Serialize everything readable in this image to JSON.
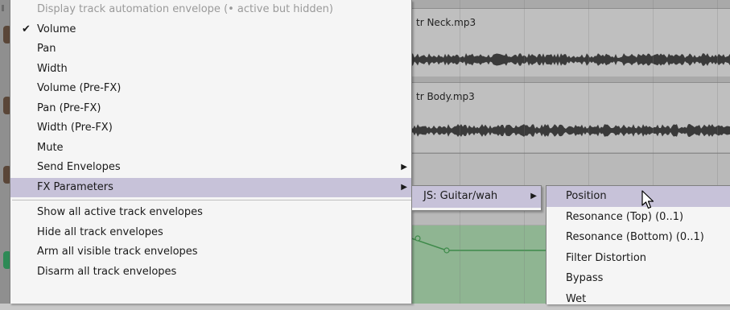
{
  "items": {
    "neck": "tr Neck.mp3",
    "body": "tr Body.mp3"
  },
  "menu": {
    "header": "Display track automation envelope (• active but hidden)",
    "check_mark": "✔",
    "submenu_arrow": "▶",
    "volume": "Volume",
    "pan": "Pan",
    "width": "Width",
    "volume_pre": "Volume (Pre-FX)",
    "pan_pre": "Pan (Pre-FX)",
    "width_pre": "Width (Pre-FX)",
    "mute": "Mute",
    "send_envelopes": "Send Envelopes",
    "fx_parameters": "FX Parameters",
    "show_all": "Show all active track envelopes",
    "hide_all": "Hide all track envelopes",
    "arm_all": "Arm all visible track envelopes",
    "disarm_all": "Disarm all track envelopes"
  },
  "fx_submenu": {
    "plugin": "JS: Guitar/wah"
  },
  "params": [
    "Position",
    "Resonance (Top) (0..1)",
    "Resonance (Bottom) (0..1)",
    "Filter Distortion",
    "Bypass",
    "Wet"
  ],
  "colors": {
    "highlight": "#c7c2d9",
    "envelope_lane": "#8fb592",
    "envelope_line": "#3e8a4a"
  },
  "icons": {
    "cursor": "mouse-pointer-icon"
  }
}
